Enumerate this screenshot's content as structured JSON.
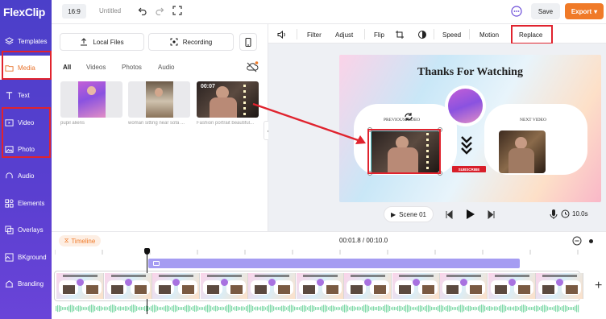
{
  "app": {
    "logo": "FlexClip",
    "aspect_ratio": "16:9",
    "project_title": "Untitled",
    "save_label": "Save",
    "export_label": "Export"
  },
  "sidebar": {
    "items": [
      {
        "label": "Templates",
        "icon": "layers-icon"
      },
      {
        "label": "Media",
        "icon": "folder-icon"
      },
      {
        "label": "Text",
        "icon": "text-icon"
      },
      {
        "label": "Video",
        "icon": "video-icon"
      },
      {
        "label": "Photo",
        "icon": "image-icon"
      },
      {
        "label": "Audio",
        "icon": "music-icon"
      },
      {
        "label": "Elements",
        "icon": "elements-icon"
      },
      {
        "label": "Overlays",
        "icon": "overlays-icon"
      },
      {
        "label": "BKground",
        "icon": "background-icon"
      },
      {
        "label": "Branding",
        "icon": "branding-icon"
      }
    ]
  },
  "media": {
    "local_files_label": "Local Files",
    "recording_label": "Recording",
    "tabs": [
      "All",
      "Videos",
      "Photos",
      "Audio"
    ],
    "items": [
      {
        "caption": "pupil aliens",
        "duration": ""
      },
      {
        "caption": "woman sitting near sofa ...",
        "duration": ""
      },
      {
        "caption": "Fashion portrait beautiful...",
        "duration": "00:07"
      }
    ]
  },
  "edit_toolbar": {
    "items": [
      "Filter",
      "Adjust",
      "Flip",
      "Speed",
      "Motion",
      "Replace"
    ]
  },
  "preview": {
    "title": "Thanks For Watching",
    "previous_label": "PREVIOUS VIDEO",
    "next_label": "NEXT VIDEO",
    "subscribe_label": "SUBSCRIBE",
    "scene_label": "Scene 01",
    "duration": "10.0s"
  },
  "timeline": {
    "tab_label": "Timeline",
    "time_readout": "00:01.8 / 00:10.0"
  },
  "colors": {
    "sidebar": "#4b3fc9",
    "accent": "#f07a28",
    "highlight_box": "#e0232e",
    "track_clip": "#a59cf2"
  }
}
